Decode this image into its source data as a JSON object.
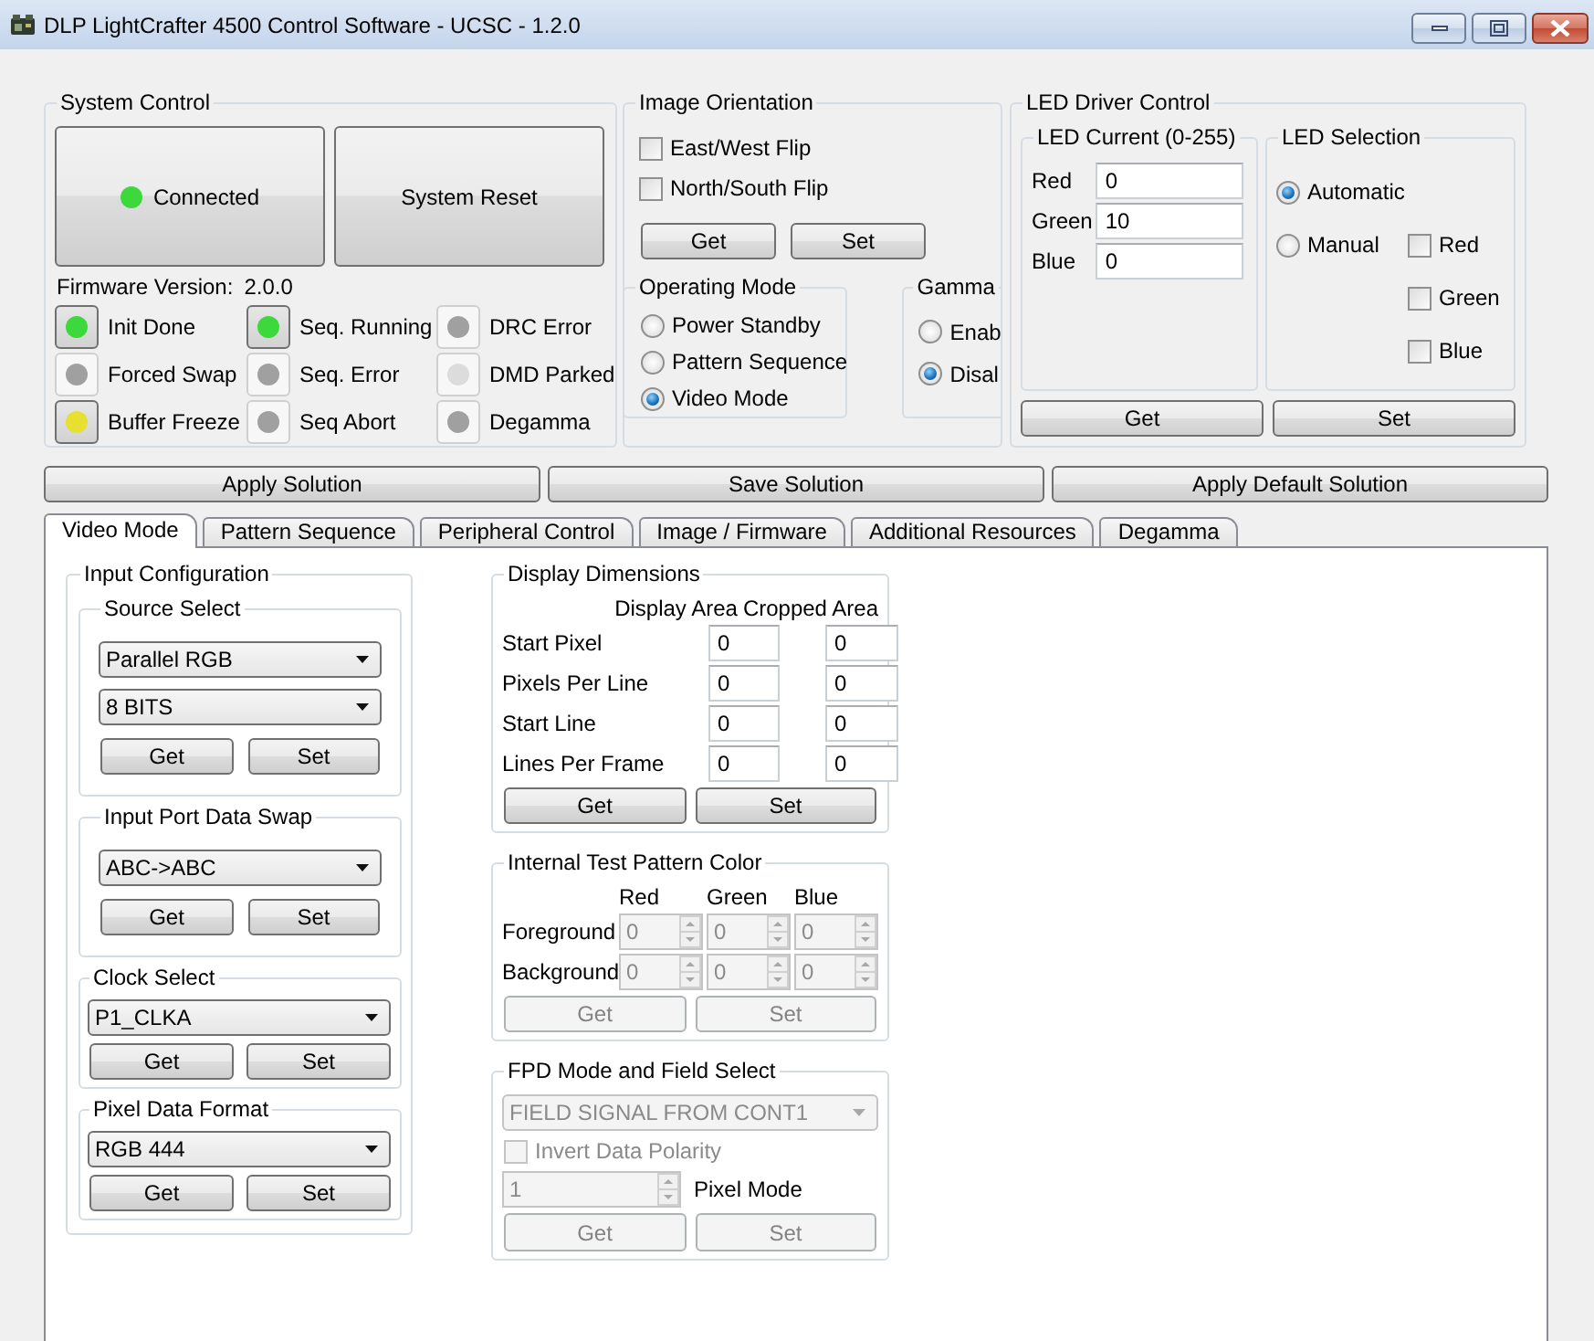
{
  "window": {
    "title": "DLP LightCrafter 4500 Control Software - UCSC - 1.2.0"
  },
  "system_control": {
    "title": "System Control",
    "buttons": [
      {
        "label": "Connected",
        "kind": "status",
        "color": "#3cd83c"
      },
      {
        "label": "System Reset",
        "kind": "plain"
      }
    ],
    "firmware": {
      "label": "Firmware Version:",
      "value": "2.0.0"
    },
    "indicators": [
      {
        "label": "Init Done",
        "on": true,
        "color": "#3cd83c"
      },
      {
        "label": "Seq. Running",
        "on": true,
        "color": "#3cd83c"
      },
      {
        "label": "DRC Error",
        "on": false,
        "color": "#a0a0a0"
      },
      {
        "label": "Forced Swap",
        "on": false,
        "color": "#a0a0a0"
      },
      {
        "label": "Seq. Error",
        "on": false,
        "color": "#a0a0a0"
      },
      {
        "label": "DMD Parked",
        "on": false,
        "color": "#dcdcdc"
      },
      {
        "label": "Buffer Freeze",
        "on": true,
        "color": "#e8e030"
      },
      {
        "label": "Seq Abort",
        "on": false,
        "color": "#a0a0a0"
      },
      {
        "label": "Degamma",
        "on": false,
        "color": "#a0a0a0"
      }
    ]
  },
  "image_orientation": {
    "title": "Image Orientation",
    "checkboxes": [
      {
        "label": "East/West Flip",
        "checked": false
      },
      {
        "label": "North/South Flip",
        "checked": false
      }
    ],
    "buttons": [
      "Get",
      "Set"
    ],
    "operating_mode": {
      "title": "Operating Mode",
      "options": [
        {
          "label": "Power Standby",
          "selected": false
        },
        {
          "label": "Pattern Sequence",
          "selected": false
        },
        {
          "label": "Video Mode",
          "selected": true
        }
      ]
    },
    "gamma": {
      "title": "Gamma",
      "options": [
        {
          "label": "Enab",
          "selected": false
        },
        {
          "label": "Disal",
          "selected": true
        }
      ]
    }
  },
  "led_driver_control": {
    "title": "LED Driver Control",
    "led_current": {
      "title": "LED Current (0-255)",
      "fields": [
        {
          "label": "Red",
          "value": "0"
        },
        {
          "label": "Green",
          "value": "10"
        },
        {
          "label": "Blue",
          "value": "0"
        }
      ]
    },
    "led_selection": {
      "title": "LED Selection",
      "modes": [
        {
          "label": "Automatic",
          "selected": true
        },
        {
          "label": "Manual",
          "selected": false
        }
      ],
      "channels": [
        {
          "label": "Red",
          "checked": false
        },
        {
          "label": "Green",
          "checked": false
        },
        {
          "label": "Blue",
          "checked": false
        }
      ]
    },
    "buttons": [
      "Get",
      "Set"
    ]
  },
  "solution_buttons": [
    "Apply Solution",
    "Save Solution",
    "Apply Default Solution"
  ],
  "tabs": [
    {
      "label": "Video Mode",
      "selected": true
    },
    {
      "label": "Pattern Sequence",
      "selected": false
    },
    {
      "label": "Peripheral Control",
      "selected": false
    },
    {
      "label": "Image / Firmware",
      "selected": false
    },
    {
      "label": "Additional Resources",
      "selected": false
    },
    {
      "label": "Degamma",
      "selected": false
    }
  ],
  "video_mode": {
    "input_configuration": {
      "title": "Input Configuration",
      "groups": [
        {
          "title": "Source Select",
          "kind": "inset",
          "dropdowns": [
            "Parallel RGB",
            "8 BITS"
          ],
          "buttons": [
            "Get",
            "Set"
          ]
        },
        {
          "title": "Input Port Data Swap",
          "kind": "inset",
          "dropdowns": [
            "ABC->ABC"
          ],
          "buttons": [
            "Get",
            "Set"
          ]
        },
        {
          "title": "Clock Select",
          "kind": "full",
          "dropdowns": [
            "P1_CLKA"
          ],
          "buttons": [
            "Get",
            "Set"
          ]
        },
        {
          "title": "Pixel Data Format",
          "kind": "full",
          "dropdowns": [
            "RGB 444"
          ],
          "buttons": [
            "Get",
            "Set"
          ]
        }
      ]
    },
    "display_dimensions": {
      "title": "Display Dimensions",
      "columns": [
        "Display Area",
        "Cropped Area"
      ],
      "rows": [
        {
          "label": "Start Pixel",
          "values": [
            "0",
            "0"
          ]
        },
        {
          "label": "Pixels Per Line",
          "values": [
            "0",
            "0"
          ]
        },
        {
          "label": "Start Line",
          "values": [
            "0",
            "0"
          ]
        },
        {
          "label": "Lines Per Frame",
          "values": [
            "0",
            "0"
          ]
        }
      ],
      "buttons": [
        "Get",
        "Set"
      ]
    },
    "test_pattern_color": {
      "title": "Internal Test Pattern Color",
      "disabled": true,
      "columns": [
        "Red",
        "Green",
        "Blue"
      ],
      "rows": [
        {
          "label": "Foreground",
          "values": [
            "0",
            "0",
            "0"
          ]
        },
        {
          "label": "Background",
          "values": [
            "0",
            "0",
            "0"
          ]
        }
      ],
      "buttons": [
        "Get",
        "Set"
      ]
    },
    "fpd_mode": {
      "title": "FPD Mode and Field Select",
      "disabled": true,
      "dropdown": "FIELD SIGNAL FROM CONT1",
      "checkbox": {
        "label": "Invert Data Polarity",
        "checked": false
      },
      "pixel_mode": {
        "value": "1",
        "label": "Pixel Mode"
      },
      "buttons": [
        "Get",
        "Set"
      ]
    }
  }
}
